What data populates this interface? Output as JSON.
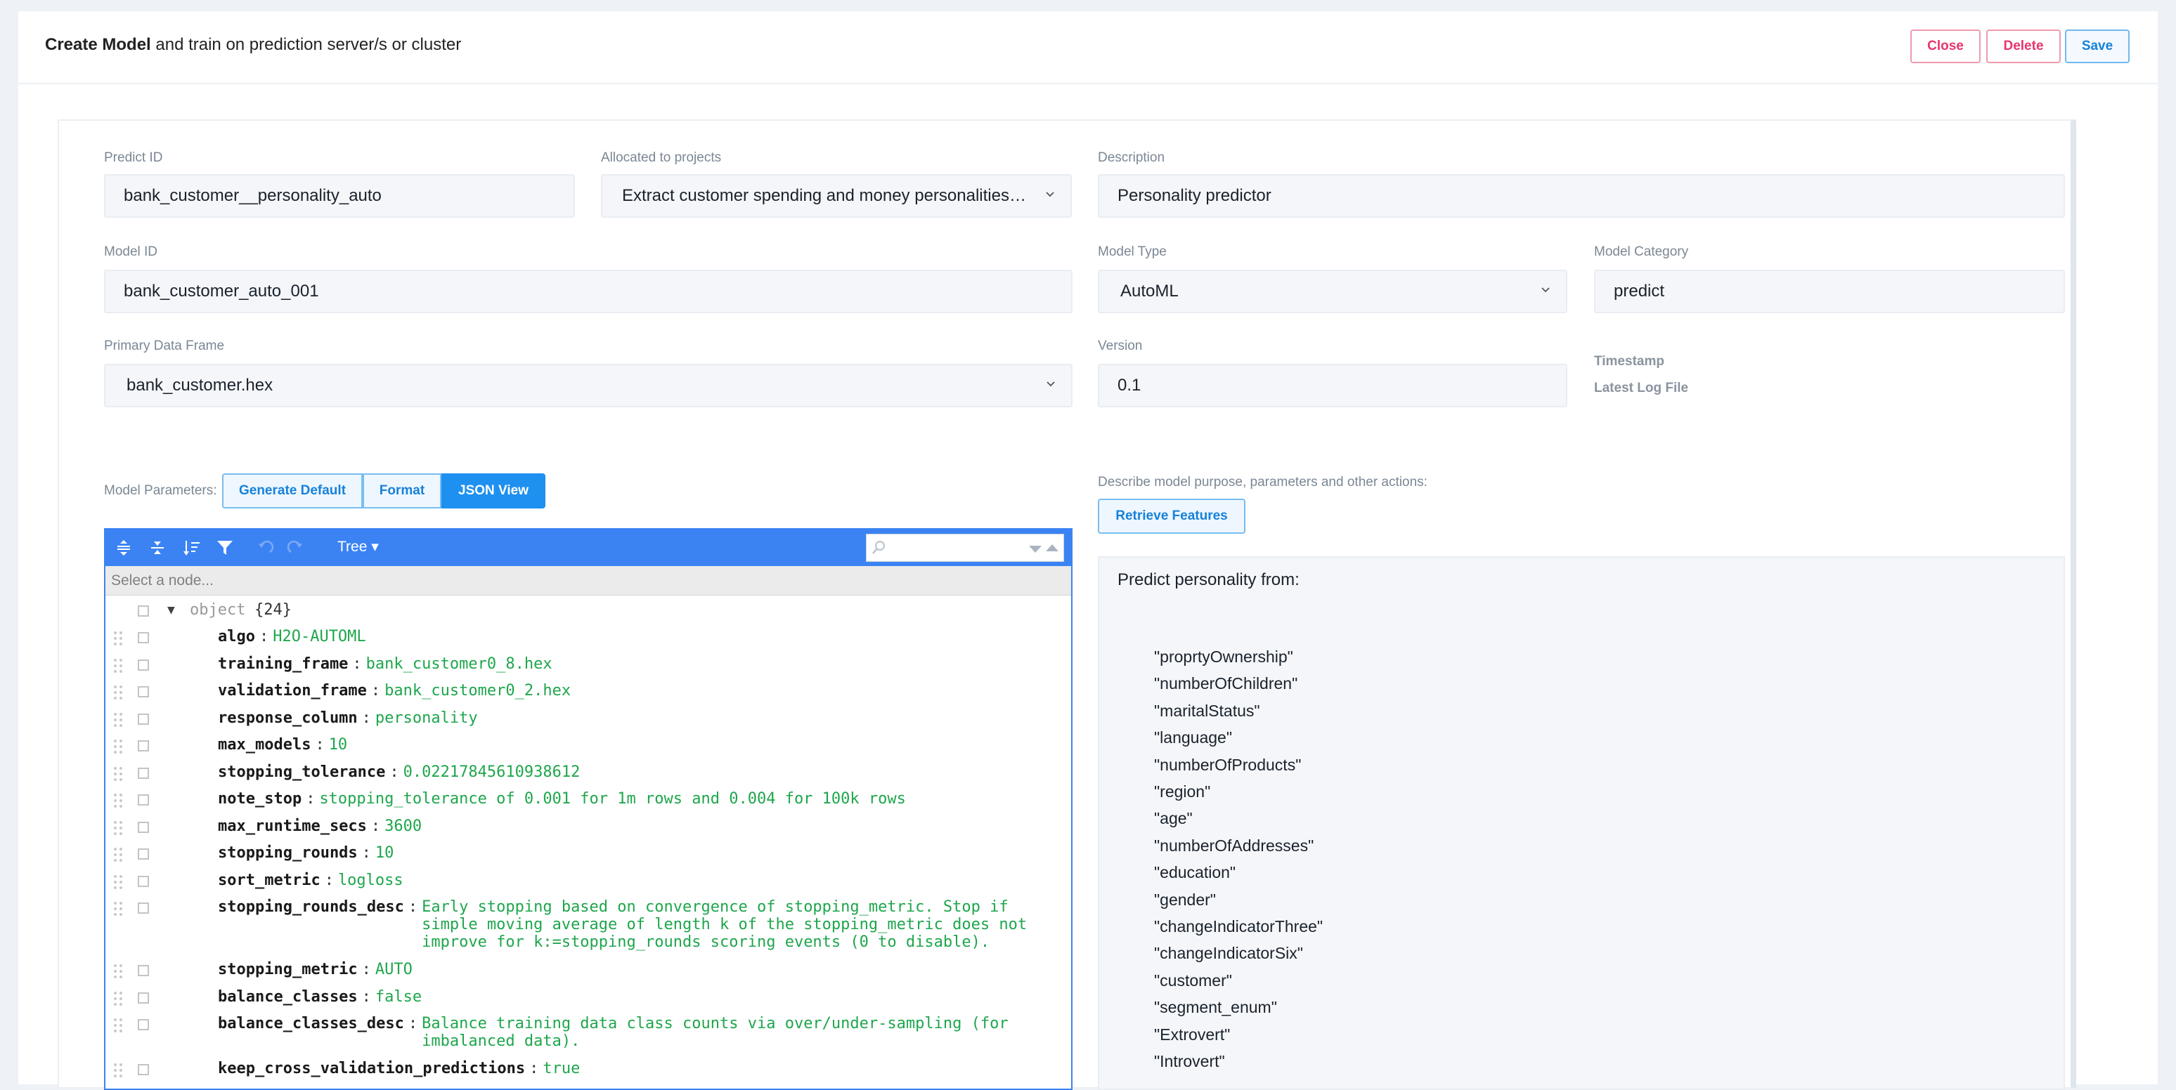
{
  "header": {
    "title_bold": "Create Model",
    "title_rest": " and train on prediction server/s or cluster",
    "close_label": "Close",
    "delete_label": "Delete",
    "save_label": "Save"
  },
  "form": {
    "predict_id": {
      "label": "Predict ID",
      "value": "bank_customer__personality_auto"
    },
    "allocated": {
      "label": "Allocated to projects",
      "value": "Extract customer spending and money personalities…"
    },
    "description": {
      "label": "Description",
      "value": "Personality predictor"
    },
    "model_id": {
      "label": "Model ID",
      "value": "bank_customer_auto_001"
    },
    "model_type": {
      "label": "Model Type",
      "value": "AutoML"
    },
    "model_category": {
      "label": "Model Category",
      "value": "predict"
    },
    "primary_frame": {
      "label": "Primary Data Frame",
      "value": "bank_customer.hex"
    },
    "version": {
      "label": "Version",
      "value": "0.1"
    },
    "timestamp_label": "Timestamp",
    "latest_log_label": "Latest Log File"
  },
  "params": {
    "label": "Model Parameters:",
    "generate_default": "Generate Default",
    "format": "Format",
    "json_view": "JSON View"
  },
  "editor": {
    "mode_label": "Tree ▾",
    "nav_placeholder": "Select a node...",
    "root": {
      "type": "object",
      "count": "{24}"
    },
    "rows": [
      {
        "key": "algo",
        "value": "H2O-AUTOML"
      },
      {
        "key": "training_frame",
        "value": "bank_customer0_8.hex"
      },
      {
        "key": "validation_frame",
        "value": "bank_customer0_2.hex"
      },
      {
        "key": "response_column",
        "value": "personality"
      },
      {
        "key": "max_models",
        "value": "10"
      },
      {
        "key": "stopping_tolerance",
        "value": "0.02217845610938612"
      },
      {
        "key": "note_stop",
        "value": "stopping_tolerance of 0.001 for 1m rows and 0.004 for 100k rows"
      },
      {
        "key": "max_runtime_secs",
        "value": "3600"
      },
      {
        "key": "stopping_rounds",
        "value": "10"
      },
      {
        "key": "sort_metric",
        "value": "logloss"
      },
      {
        "key": "stopping_rounds_desc",
        "value": "Early stopping based on convergence of stopping_metric. Stop if\nsimple moving average of length k of the stopping_metric does not\nimprove for k:=stopping_rounds scoring events (0 to disable)."
      },
      {
        "key": "stopping_metric",
        "value": "AUTO"
      },
      {
        "key": "balance_classes",
        "value": "false"
      },
      {
        "key": "balance_classes_desc",
        "value": "Balance training data class counts via over/under-sampling (for\nimbalanced data)."
      },
      {
        "key": "keep_cross_validation_predictions",
        "value": "true"
      }
    ]
  },
  "describe": {
    "label": "Describe model purpose, parameters and other actions:",
    "retrieve_button": "Retrieve Features",
    "title": "Predict personality from:",
    "features": [
      "\"proprtyOwnership\"",
      "\"numberOfChildren\"",
      "\"maritalStatus\"",
      "\"language\"",
      "\"numberOfProducts\"",
      "\"region\"",
      "\"age\"",
      "\"numberOfAddresses\"",
      "\"education\"",
      "\"gender\"",
      "\"changeIndicatorThree\"",
      "\"changeIndicatorSix\"",
      "\"customer\"",
      "\"segment_enum\"",
      "\"Extrovert\"",
      "\"Introvert\""
    ]
  }
}
